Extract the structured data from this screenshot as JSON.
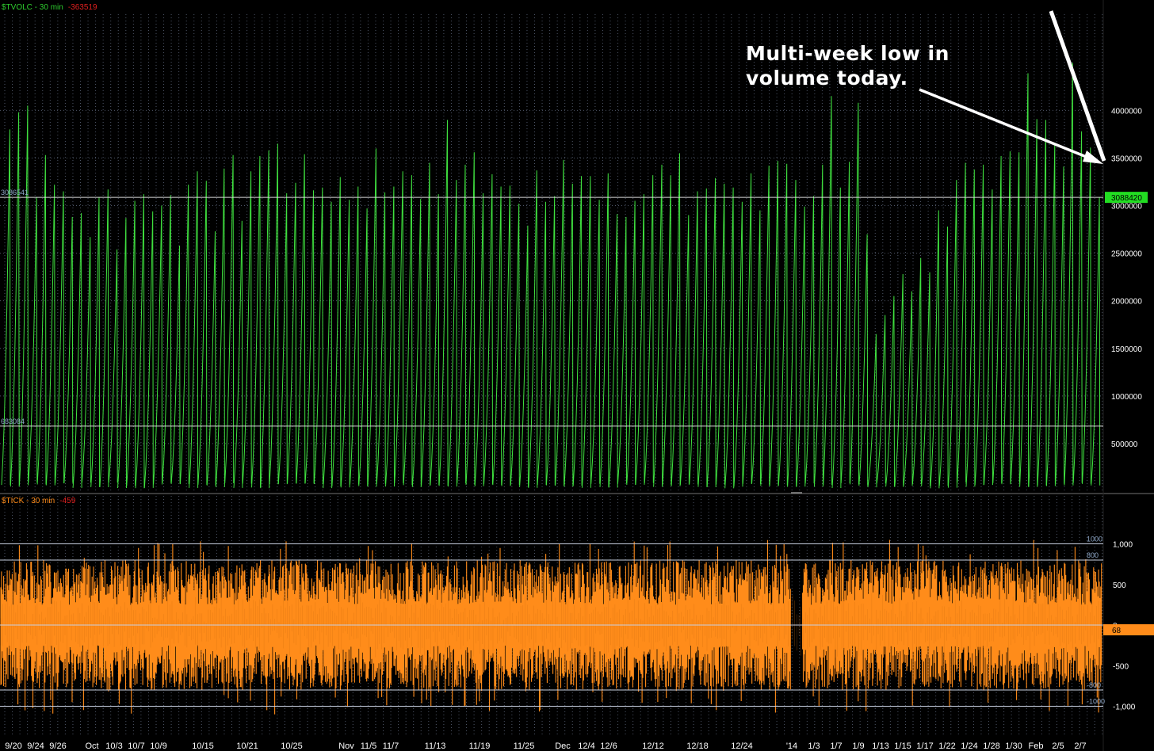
{
  "chart_data": [
    {
      "type": "line",
      "title": "$TVOLC - 30 min",
      "last_change": "-363519",
      "colors": {
        "title": "#2ecc2e",
        "change": "#e0201f",
        "line": "#3fe03f",
        "grid": "#4d5566",
        "last_badge": "#22dd22"
      },
      "y_ticks": [
        "4000000",
        "3500000",
        "3000000",
        "2500000",
        "2000000",
        "1500000",
        "1000000",
        "500000"
      ],
      "ylim": [
        0,
        4700000
      ],
      "hlines": [
        {
          "label_left": "3086541",
          "label_right": "3088420",
          "value": 3086541
        },
        {
          "label_left": "683084",
          "value": 683084
        }
      ],
      "last_value": "3088420",
      "series": [
        {
          "values": [
            3800000,
            3980000,
            4050000,
            3090000,
            3530000,
            3220000,
            3150000,
            2880000,
            2920000,
            2670000,
            3090000,
            3170000,
            2540000,
            2870000,
            3050000,
            3120000,
            2940000,
            3000000,
            3110000,
            2580000,
            3220000,
            3360000,
            3260000,
            2730000,
            3390000,
            3530000,
            2840000,
            3360000,
            3520000,
            3580000,
            3650000,
            3130000,
            3240000,
            3540000,
            3160000,
            3190000,
            3040000,
            3300000,
            3060000,
            3200000,
            2970000,
            3600000,
            3140000,
            3200000,
            3360000,
            3320000,
            3070000,
            3450000,
            3120000,
            3900000,
            3270000,
            3430000,
            3560000,
            3130000,
            3330000,
            3200000,
            3210000,
            3020000,
            2790000,
            3370000,
            3040000,
            3100000,
            3480000,
            3230000,
            3310000,
            3310000,
            3060000,
            3340000,
            2910000,
            2880000,
            3050000,
            3120000,
            3320000,
            3430000,
            3320000,
            3550000,
            2900000,
            3150000,
            3180000,
            3290000,
            3230000,
            3190000,
            3040000,
            3340000,
            2950000,
            3420000,
            3470000,
            3440000,
            3270000,
            2990000,
            3100000,
            3430000,
            4150000,
            3190000,
            3460000,
            4080000,
            2700000,
            1650000,
            1850000,
            2050000,
            2280000,
            2100000,
            2450000,
            2300000,
            2950000,
            2780000,
            3270000,
            3450000,
            3380000,
            3430000,
            3170000,
            3520000,
            3570000,
            3560000,
            4390000,
            3910000,
            3900000,
            3660000,
            3410000,
            4500000,
            3780000,
            3610000,
            3088420
          ],
          "notes": "cumulative intraday volume, sawtooth resetting to near zero each session"
        }
      ]
    },
    {
      "type": "area",
      "title": "$TICK - 30 min",
      "last_change": "-459",
      "colors": {
        "title": "#ff8c1a",
        "change": "#e0201f",
        "bars": "#ff8c1a",
        "grid": "#4d5566",
        "last_badge": "#ff8c1a"
      },
      "y_ticks": [
        "1,000",
        "500",
        "0",
        "-500",
        "-1,000"
      ],
      "ylim": [
        -1250,
        1000
      ],
      "hlines": [
        {
          "label": "1000",
          "value": 1000
        },
        {
          "label": "800",
          "value": 800
        },
        {
          "label": "-800",
          "value": -800
        },
        {
          "label": "-1000",
          "value": -1000
        }
      ],
      "last_value": "68",
      "series": [
        {
          "range_high": 1150,
          "range_low": -1240,
          "notes": "NYSE TICK high/low bars oscillating roughly between -900 and +900"
        }
      ]
    }
  ],
  "x_axis": {
    "tick_labels": [
      "9/20",
      "9/24",
      "9/26",
      "Oct",
      "10/3",
      "10/7",
      "10/9",
      "10/15",
      "10/21",
      "10/25",
      "Nov",
      "11/5",
      "11/7",
      "11/13",
      "11/19",
      "11/25",
      "Dec",
      "12/4",
      "12/6",
      "12/12",
      "12/18",
      "12/24",
      "'14",
      "1/3",
      "1/7",
      "1/9",
      "1/13",
      "1/15",
      "1/17",
      "1/22",
      "1/24",
      "1/28",
      "1/30",
      "Feb",
      "2/5",
      "2/7"
    ],
    "label_color": "#ffffff"
  },
  "annotation": {
    "line1": "Multi-week low in",
    "line2": "volume today."
  }
}
